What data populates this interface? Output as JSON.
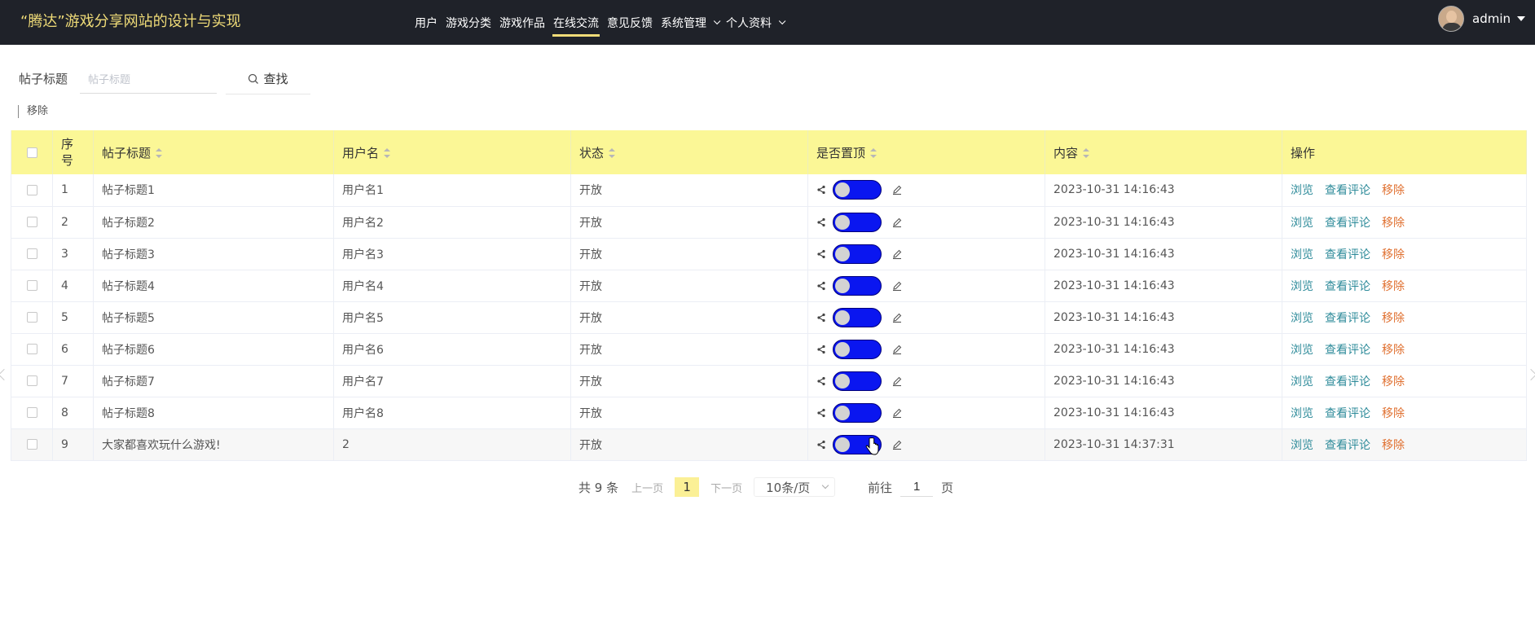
{
  "app": {
    "title": "“腾达”游戏分享网站的设计与实现"
  },
  "nav": [
    {
      "label": "用户",
      "active": false,
      "dropdown": false
    },
    {
      "label": "游戏分类",
      "active": false,
      "dropdown": false
    },
    {
      "label": "游戏作品",
      "active": false,
      "dropdown": false
    },
    {
      "label": "在线交流",
      "active": true,
      "dropdown": false
    },
    {
      "label": "意见反馈",
      "active": false,
      "dropdown": false
    },
    {
      "label": "系统管理",
      "active": false,
      "dropdown": true
    },
    {
      "label": "个人资料",
      "active": false,
      "dropdown": true
    }
  ],
  "user": {
    "name": "admin"
  },
  "search": {
    "label": "帖子标题",
    "placeholder": "帖子标题",
    "value": "",
    "button": "查找"
  },
  "toolbar": {
    "remove": "移除"
  },
  "table": {
    "headers": [
      "序号",
      "帖子标题",
      "用户名",
      "状态",
      "是否置顶",
      "内容",
      "操作"
    ],
    "rows": [
      {
        "index": "1",
        "title": "帖子标题1",
        "user": "用户名1",
        "status": "开放",
        "pinned": true,
        "content": "2023-10-31 14:16:43"
      },
      {
        "index": "2",
        "title": "帖子标题2",
        "user": "用户名2",
        "status": "开放",
        "pinned": true,
        "content": "2023-10-31 14:16:43"
      },
      {
        "index": "3",
        "title": "帖子标题3",
        "user": "用户名3",
        "status": "开放",
        "pinned": true,
        "content": "2023-10-31 14:16:43"
      },
      {
        "index": "4",
        "title": "帖子标题4",
        "user": "用户名4",
        "status": "开放",
        "pinned": true,
        "content": "2023-10-31 14:16:43"
      },
      {
        "index": "5",
        "title": "帖子标题5",
        "user": "用户名5",
        "status": "开放",
        "pinned": true,
        "content": "2023-10-31 14:16:43"
      },
      {
        "index": "6",
        "title": "帖子标题6",
        "user": "用户名6",
        "status": "开放",
        "pinned": true,
        "content": "2023-10-31 14:16:43"
      },
      {
        "index": "7",
        "title": "帖子标题7",
        "user": "用户名7",
        "status": "开放",
        "pinned": true,
        "content": "2023-10-31 14:16:43"
      },
      {
        "index": "8",
        "title": "帖子标题8",
        "user": "用户名8",
        "status": "开放",
        "pinned": true,
        "content": "2023-10-31 14:16:43"
      },
      {
        "index": "9",
        "title": "大家都喜欢玩什么游戏!",
        "user": "2",
        "status": "开放",
        "pinned": true,
        "content": "2023-10-31 14:37:31"
      }
    ],
    "actions": {
      "view": "浏览",
      "comments": "查看评论",
      "remove": "移除"
    }
  },
  "pagination": {
    "total": "共 9 条",
    "prev": "上一页",
    "current": "1",
    "next": "下一页",
    "page_size": "10条/页",
    "goto_label": "前往",
    "goto_value": "1",
    "page_suffix": "页"
  },
  "colors": {
    "navbar": "#1f2229",
    "brand": "#f0dc78",
    "table_header": "#fbf796",
    "toggle_on": "#0a16f0",
    "link_teal": "#2e8b9a",
    "link_orange": "#e07030"
  }
}
